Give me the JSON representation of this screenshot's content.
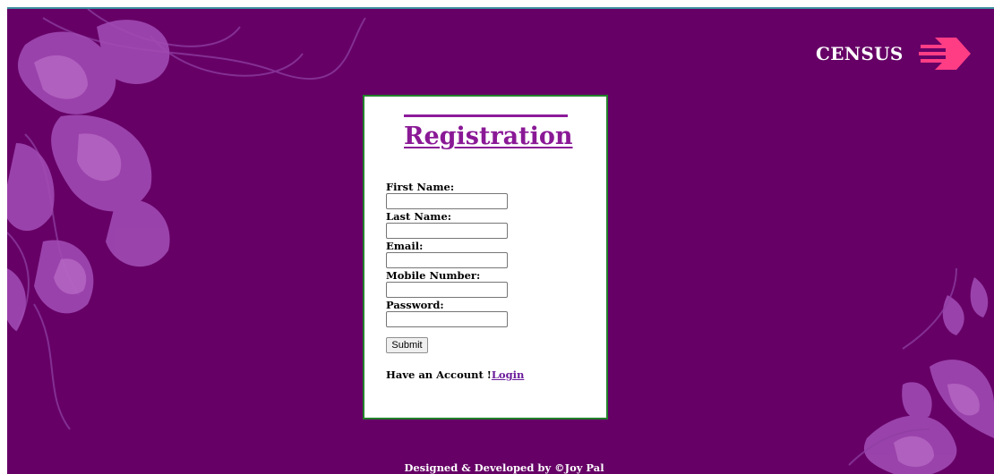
{
  "brand": {
    "name": "CENSUS",
    "icon": "fast-arrow-icon"
  },
  "colors": {
    "background": "#660066",
    "floral": "#a04ab3",
    "accent": "#ff3d85",
    "title": "#8a1996",
    "card_border": "#22802a",
    "link": "#6a1b9a"
  },
  "form": {
    "title": "Registration",
    "fields": [
      {
        "label": "First Name:",
        "value": ""
      },
      {
        "label": "Last Name:",
        "value": ""
      },
      {
        "label": "Email:",
        "value": ""
      },
      {
        "label": "Mobile Number:",
        "value": ""
      },
      {
        "label": "Password:",
        "value": ""
      }
    ],
    "submit_label": "Submit",
    "account_prompt": "Have an Account !",
    "login_link": "Login"
  },
  "footer": {
    "credit": "Designed & Developed by ©Joy Pal"
  }
}
